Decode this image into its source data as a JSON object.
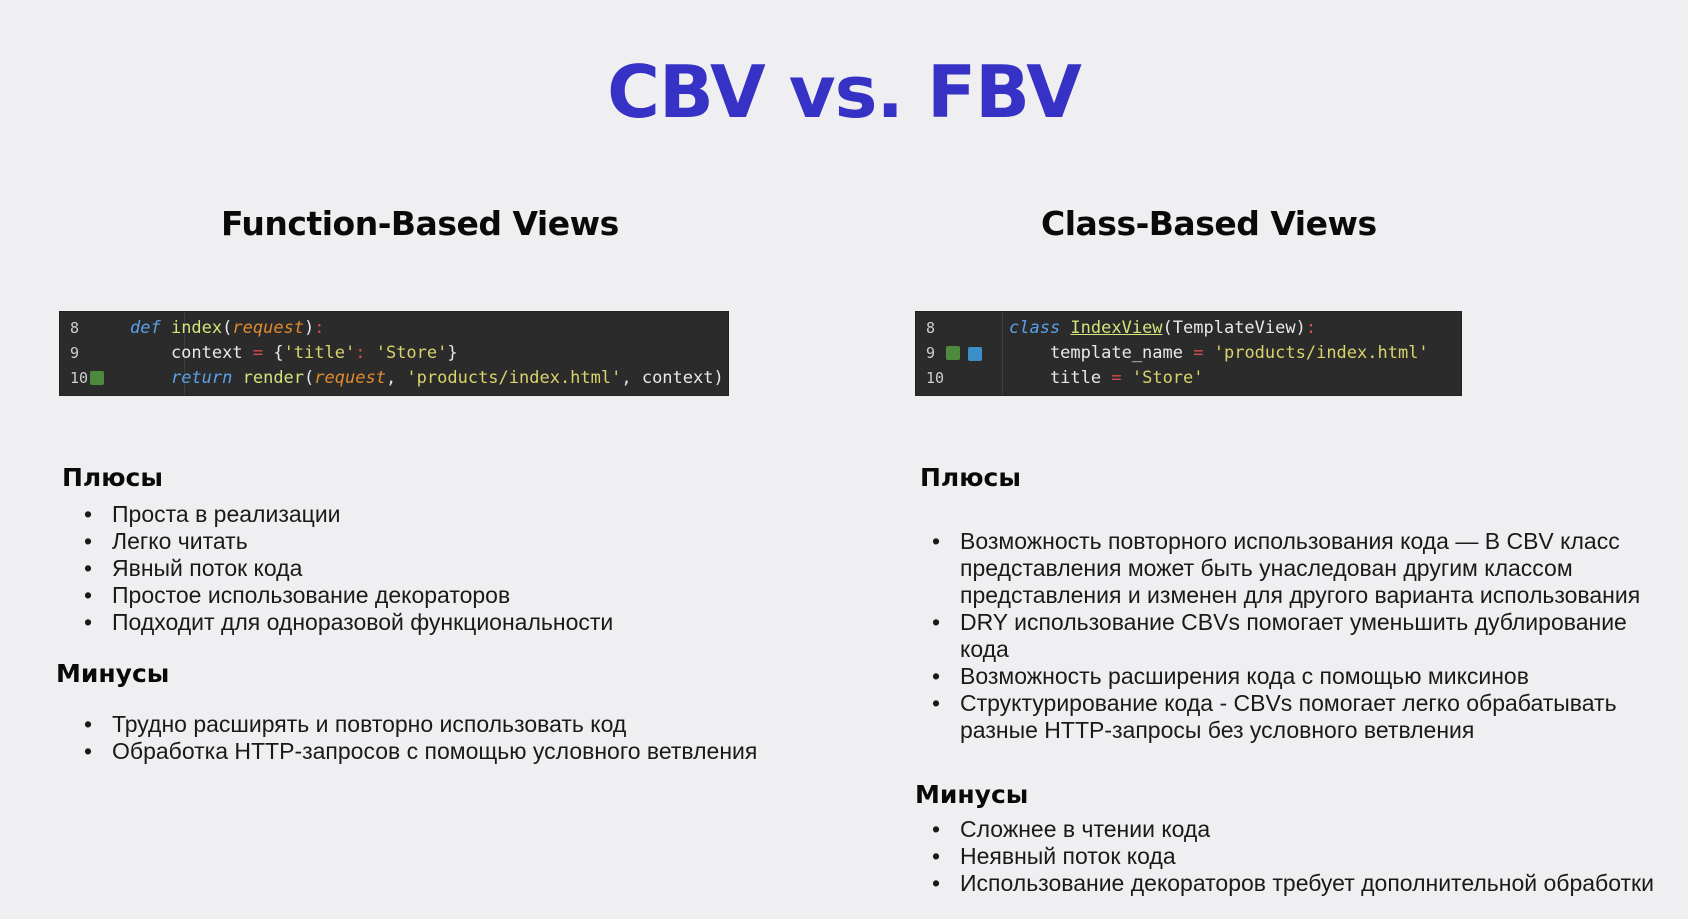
{
  "title": "CBV vs. FBV",
  "left": {
    "heading": "Function-Based Views",
    "code": {
      "lines": [
        {
          "no": "8",
          "tokens": [
            {
              "cls": "kw",
              "text": "def "
            },
            {
              "cls": "fn",
              "text": "index"
            },
            {
              "cls": "plain",
              "text": "("
            },
            {
              "cls": "param",
              "text": "request"
            },
            {
              "cls": "plain",
              "text": ")"
            },
            {
              "cls": "op",
              "text": ":"
            }
          ]
        },
        {
          "no": "9",
          "tokens": [
            {
              "cls": "plain",
              "text": "    context "
            },
            {
              "cls": "op",
              "text": "="
            },
            {
              "cls": "plain",
              "text": " {"
            },
            {
              "cls": "str",
              "text": "'title'"
            },
            {
              "cls": "op",
              "text": ":"
            },
            {
              "cls": "plain",
              "text": " "
            },
            {
              "cls": "str",
              "text": "'Store'"
            },
            {
              "cls": "plain",
              "text": "}"
            }
          ]
        },
        {
          "no": "10",
          "tokens": [
            {
              "cls": "plain",
              "text": "    "
            },
            {
              "cls": "kw",
              "text": "return "
            },
            {
              "cls": "fn",
              "text": "render"
            },
            {
              "cls": "plain",
              "text": "("
            },
            {
              "cls": "param",
              "text": "request"
            },
            {
              "cls": "plain",
              "text": ", "
            },
            {
              "cls": "str",
              "text": "'products/index.html'"
            },
            {
              "cls": "plain",
              "text": ", context)"
            }
          ]
        }
      ]
    },
    "pros_heading": "Плюсы",
    "pros": [
      "Проста в реализации",
      "Легко читать",
      "Явный поток кода",
      "Простое использование декораторов",
      "Подходит для одноразовой функциональности"
    ],
    "cons_heading": "Минусы",
    "cons": [
      "Трудно расширять и повторно использовать код",
      "Обработка HTTP-запросов с помощью условного ветвления"
    ]
  },
  "right": {
    "heading": "Class-Based Views",
    "code": {
      "lines": [
        {
          "no": "8",
          "tokens": [
            {
              "cls": "kw",
              "text": "class "
            },
            {
              "cls": "cls",
              "text": "IndexView"
            },
            {
              "cls": "plain",
              "text": "(TemplateView)"
            },
            {
              "cls": "op",
              "text": ":"
            }
          ]
        },
        {
          "no": "9",
          "tokens": [
            {
              "cls": "plain",
              "text": "    template_name "
            },
            {
              "cls": "op",
              "text": "="
            },
            {
              "cls": "plain",
              "text": " "
            },
            {
              "cls": "str",
              "text": "'products/index.html'"
            }
          ]
        },
        {
          "no": "10",
          "tokens": [
            {
              "cls": "plain",
              "text": "    title "
            },
            {
              "cls": "op",
              "text": "="
            },
            {
              "cls": "plain",
              "text": " "
            },
            {
              "cls": "str",
              "text": "'Store'"
            }
          ]
        }
      ]
    },
    "pros_heading": "Плюсы",
    "pros": [
      "Возможность повторного использования кода — В CBV класс представления может быть унаследован другим классом представления и изменен для другого варианта использования",
      "DRY использование CBVs помогает уменьшить дублирование кода",
      "Возможность расширения кода с помощью миксинов",
      "Структурирование кода - CBVs помогает легко обрабатывать разные HTTP-запросы без условного ветвления"
    ],
    "cons_heading": "Минусы",
    "cons": [
      "Сложнее в чтении кода",
      "Неявный поток кода",
      "Использование декораторов требует дополнительной обработки"
    ]
  }
}
